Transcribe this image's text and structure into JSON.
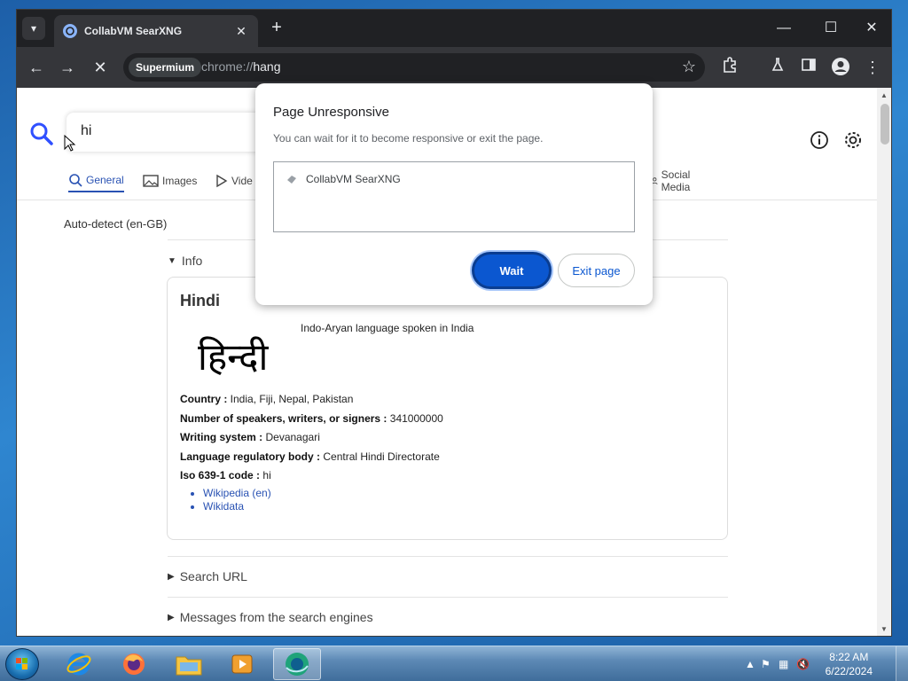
{
  "browser": {
    "tab_title": "CollabVM SearXNG",
    "tab_close": "✕",
    "new_tab": "+",
    "chip": "Supermium",
    "url_scheme": "chrome://",
    "url_host": "hang"
  },
  "searx": {
    "query": "hi",
    "categories": [
      {
        "label": "General",
        "icon": "search-icon"
      },
      {
        "label": "Images",
        "icon": "image-icon"
      },
      {
        "label": "Vide",
        "icon": "play-icon"
      },
      {
        "label": "Social Media",
        "icon": "person-icon"
      }
    ],
    "autodetect": "Auto-detect (en-GB)",
    "info_label": "Info",
    "search_url_label": "Search URL",
    "messages_label": "Messages from the search engines"
  },
  "infobox": {
    "title": "Hindi",
    "image_text": "हिन्दी",
    "description": "Indo-Aryan language spoken in India",
    "attributes": [
      {
        "key": "Country :",
        "value": "India, Fiji, Nepal, Pakistan"
      },
      {
        "key": "Number of speakers, writers, or signers :",
        "value": "341000000"
      },
      {
        "key": "Writing system :",
        "value": "Devanagari"
      },
      {
        "key": "Language regulatory body :",
        "value": "Central Hindi Directorate"
      },
      {
        "key": "Iso 639-1 code :",
        "value": "hi"
      }
    ],
    "links": [
      "Wikipedia (en)",
      "Wikidata"
    ]
  },
  "dialog": {
    "title": "Page Unresponsive",
    "message": "You can wait for it to become responsive or exit the page.",
    "item": "CollabVM SearXNG",
    "wait_label": "Wait",
    "exit_label": "Exit page"
  },
  "taskbar": {
    "time": "8:22 AM",
    "date": "6/22/2024"
  },
  "colors": {
    "accent": "#0b57d0",
    "searx_blue": "#2952b3"
  }
}
